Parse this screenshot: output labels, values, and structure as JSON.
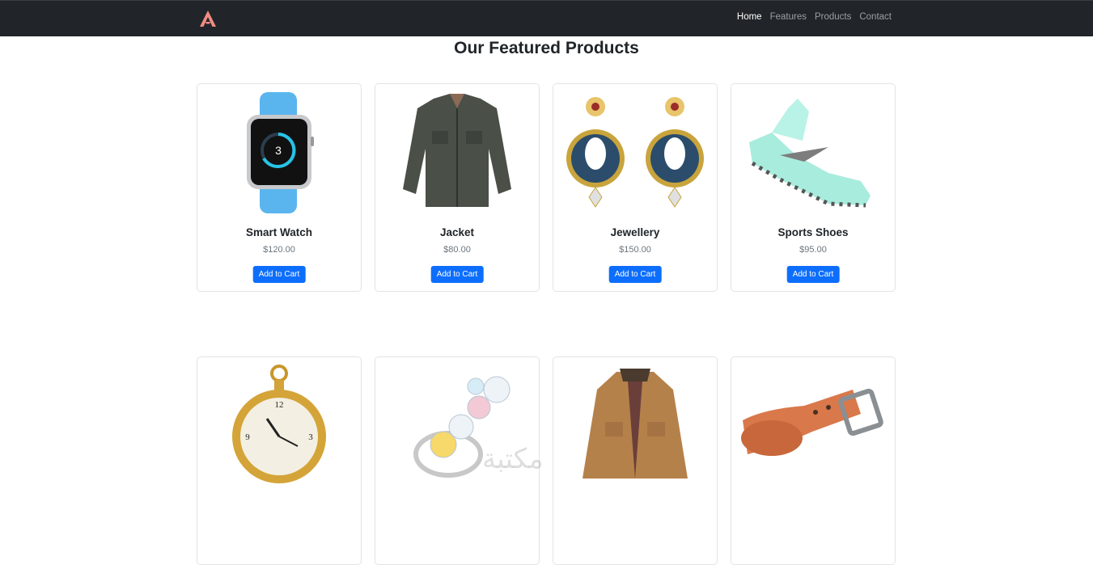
{
  "navbar": {
    "brand_icon": "letter-a-logo",
    "brand_color": "#f28b82",
    "links": [
      {
        "label": "Home",
        "active": true
      },
      {
        "label": "Features",
        "active": false
      },
      {
        "label": "Products",
        "active": false
      },
      {
        "label": "Contact",
        "active": false
      }
    ]
  },
  "main": {
    "title": "Our Featured Products",
    "products": [
      {
        "name": "Smart Watch",
        "price": "$120.00",
        "button": "Add to Cart",
        "image": "smart-watch-image"
      },
      {
        "name": "Jacket",
        "price": "$80.00",
        "button": "Add to Cart",
        "image": "jacket-image"
      },
      {
        "name": "Jewellery",
        "price": "$150.00",
        "button": "Add to Cart",
        "image": "earrings-image"
      },
      {
        "name": "Sports Shoes",
        "price": "$95.00",
        "button": "Add to Cart",
        "image": "sports-shoe-image"
      }
    ],
    "products_row2": [
      {
        "image": "pocket-watch-image"
      },
      {
        "image": "diamond-ring-image"
      },
      {
        "image": "brown-jacket-image"
      },
      {
        "image": "leather-belt-image"
      }
    ]
  },
  "colors": {
    "navbar_bg": "#212529",
    "button_bg": "#0d6efd"
  },
  "watermark": "مكتبة"
}
